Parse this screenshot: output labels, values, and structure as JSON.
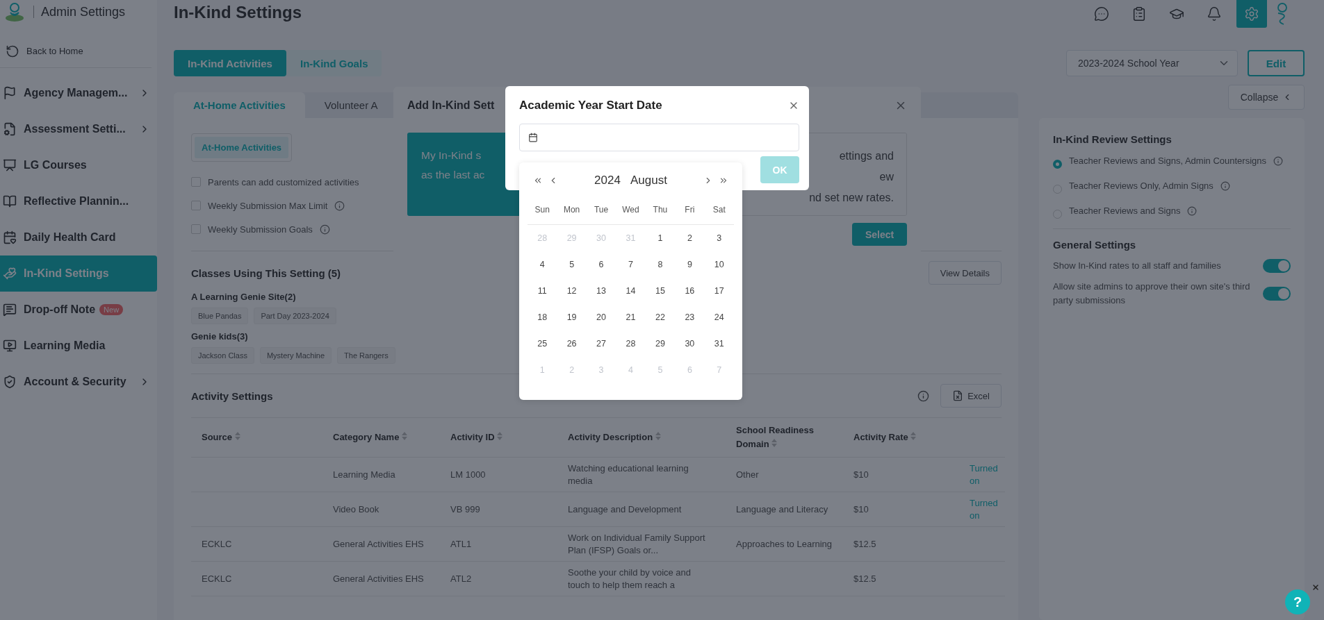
{
  "app": {
    "title": "Admin Settings"
  },
  "sidebar": {
    "back": "Back to Home",
    "items": [
      {
        "label": "Agency Managem...",
        "selected": false,
        "expandable": true
      },
      {
        "label": "Assessment Setti...",
        "selected": false,
        "expandable": true
      },
      {
        "label": "LG Courses",
        "selected": false,
        "expandable": false
      },
      {
        "label": "Reflective Plannin...",
        "selected": false,
        "expandable": false
      },
      {
        "label": "Daily Health Card",
        "selected": false,
        "expandable": false
      },
      {
        "label": "In-Kind Settings",
        "selected": true,
        "expandable": false
      },
      {
        "label": "Drop-off Note",
        "selected": false,
        "expandable": false,
        "badge": "New"
      },
      {
        "label": "Learning Media",
        "selected": false,
        "expandable": false
      },
      {
        "label": "Account & Security",
        "selected": false,
        "expandable": true
      }
    ]
  },
  "page": {
    "title": "In-Kind Settings"
  },
  "top_icons": [
    {
      "selected": false
    },
    {
      "selected": false
    },
    {
      "selected": false
    },
    {
      "selected": false
    },
    {
      "selected": true
    }
  ],
  "main_tabs": [
    {
      "label": "In-Kind Activities",
      "selected": true
    },
    {
      "label": "In-Kind Goals",
      "selected": false
    }
  ],
  "school_year": {
    "value": "2023-2024 School Year"
  },
  "edit_button": "Edit",
  "collapse_button": "Collapse",
  "setting_tabs": [
    {
      "label": "At-Home Activities",
      "selected": true
    },
    {
      "label": "Volunteer A",
      "selected": false
    }
  ],
  "activity_types": [
    {
      "label": "At-Home Activities",
      "selected": true
    }
  ],
  "options": [
    {
      "label": "Parents can add customized activities",
      "checked": false
    },
    {
      "label": "Weekly Submission Max Limit",
      "checked": false,
      "info": true
    },
    {
      "label": "Weekly Submission Goals",
      "checked": false,
      "info": true
    }
  ],
  "classes": {
    "title": "Classes Using This Setting (5)",
    "view_button": "View Details",
    "groups": [
      {
        "name": "A Learning Genie Site(2)",
        "classes": [
          "Blue Pandas",
          "Part Day 2023-2024"
        ]
      },
      {
        "name": "Genie kids(3)",
        "classes": [
          "Jackson Class",
          "Mystery Machine",
          "The Rangers"
        ]
      }
    ]
  },
  "activity_settings": {
    "title": "Activity Settings",
    "export_button": "Excel",
    "columns": [
      {
        "label": "Source",
        "sortable": true
      },
      {
        "label": "Category Name",
        "sortable": true
      },
      {
        "label": "Activity ID",
        "sortable": true
      },
      {
        "label": "Activity Description",
        "sortable": true
      },
      {
        "label": "School Readiness Domain",
        "sortable": true
      },
      {
        "label": "Activity Rate",
        "sortable": true
      }
    ],
    "rows": [
      {
        "category": "Learning Media",
        "activity_id": "LM 1000",
        "description": "Watching educational learning media",
        "domain": "Other",
        "rate": "$10",
        "status": "Turned on"
      },
      {
        "category": "Video Book",
        "activity_id": "VB 999",
        "description": "Language and Development",
        "domain": "Language and Literacy",
        "rate": "$10",
        "status": "Turned on"
      },
      {
        "source": "ECKLC",
        "category": "General Activities EHS",
        "activity_id": "ATL1",
        "description": "Work on Individual Family Support Plan (IFSP) Goals or...",
        "domain": "Approaches to Learning",
        "rate": "$12.5"
      },
      {
        "source": "ECKLC",
        "category": "General Activities EHS",
        "activity_id": "ATL2",
        "description": "Soothe your child by voice and touch to help them reach a",
        "rate": "$12.5"
      }
    ]
  },
  "review_settings": {
    "title": "In-Kind Review Settings",
    "options": [
      {
        "label": "Teacher Reviews and Signs, Admin Countersigns",
        "selected": true
      },
      {
        "label": "Teacher Reviews Only, Admin Signs",
        "selected": false
      },
      {
        "label": "Teacher Reviews and Signs",
        "selected": false
      }
    ]
  },
  "general_settings": {
    "title": "General Settings",
    "toggles": [
      {
        "label": "Show In-Kind rates to all staff and families",
        "on": true
      },
      {
        "label": "Allow site admins to approve their own site's third party submissions",
        "on": true
      }
    ]
  },
  "add_dialog": {
    "title": "Add In-Kind Sett",
    "card_lines": [
      "My In-Kind s",
      "as the last ac"
    ],
    "other_lines": [
      "ettings and",
      "ew",
      "nd set new rates."
    ],
    "select_button": "Select"
  },
  "date_dialog": {
    "title": "Academic Year Start Date",
    "ok_button": "OK",
    "ok_disabled": true
  },
  "calendar": {
    "year": "2024",
    "month": "August",
    "weekdays": [
      "Sun",
      "Mon",
      "Tue",
      "Wed",
      "Thu",
      "Fri",
      "Sat"
    ],
    "weeks": [
      [
        {
          "day": "28",
          "in_month": false
        },
        {
          "day": "29",
          "in_month": false
        },
        {
          "day": "30",
          "in_month": false
        },
        {
          "day": "31",
          "in_month": false
        },
        {
          "day": "1",
          "in_month": true
        },
        {
          "day": "2",
          "in_month": true
        },
        {
          "day": "3",
          "in_month": true
        }
      ],
      [
        {
          "day": "4",
          "in_month": true
        },
        {
          "day": "5",
          "in_month": true
        },
        {
          "day": "6",
          "in_month": true
        },
        {
          "day": "7",
          "in_month": true
        },
        {
          "day": "8",
          "in_month": true
        },
        {
          "day": "9",
          "in_month": true
        },
        {
          "day": "10",
          "in_month": true
        }
      ],
      [
        {
          "day": "11",
          "in_month": true
        },
        {
          "day": "12",
          "in_month": true
        },
        {
          "day": "13",
          "in_month": true
        },
        {
          "day": "14",
          "in_month": true
        },
        {
          "day": "15",
          "in_month": true
        },
        {
          "day": "16",
          "in_month": true
        },
        {
          "day": "17",
          "in_month": true
        }
      ],
      [
        {
          "day": "18",
          "in_month": true
        },
        {
          "day": "19",
          "in_month": true
        },
        {
          "day": "20",
          "in_month": true
        },
        {
          "day": "21",
          "in_month": true
        },
        {
          "day": "22",
          "in_month": true
        },
        {
          "day": "23",
          "in_month": true
        },
        {
          "day": "24",
          "in_month": true
        }
      ],
      [
        {
          "day": "25",
          "in_month": true
        },
        {
          "day": "26",
          "in_month": true
        },
        {
          "day": "27",
          "in_month": true
        },
        {
          "day": "28",
          "in_month": true
        },
        {
          "day": "29",
          "in_month": true
        },
        {
          "day": "30",
          "in_month": true
        },
        {
          "day": "31",
          "in_month": true
        }
      ],
      [
        {
          "day": "1",
          "in_month": false
        },
        {
          "day": "2",
          "in_month": false
        },
        {
          "day": "3",
          "in_month": false
        },
        {
          "day": "4",
          "in_month": false
        },
        {
          "day": "5",
          "in_month": false
        },
        {
          "day": "6",
          "in_month": false
        },
        {
          "day": "7",
          "in_month": false
        }
      ]
    ]
  },
  "help_button": "?"
}
